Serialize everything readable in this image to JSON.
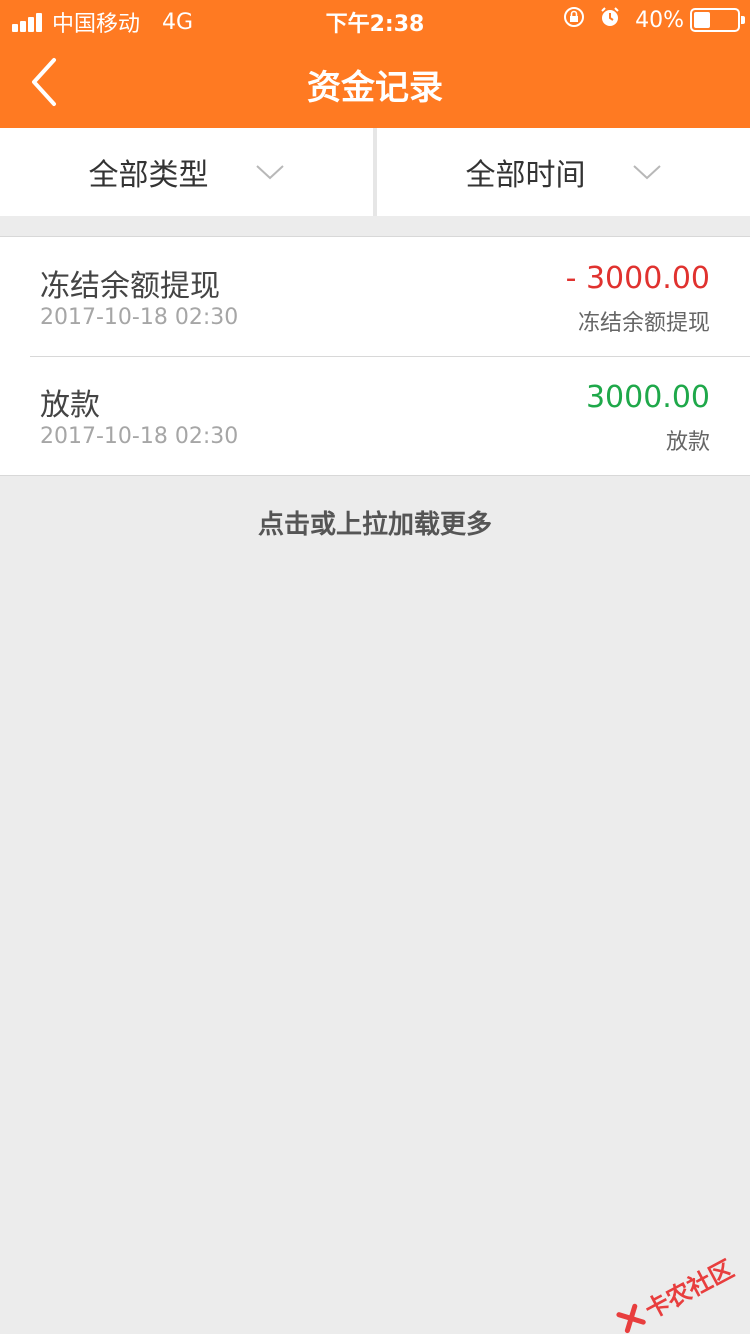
{
  "status_bar": {
    "carrier": "中国移动",
    "network": "4G",
    "time": "下午2:38",
    "battery": "40%",
    "battery_level": 0.4
  },
  "navbar": {
    "title": "资金记录"
  },
  "filters": [
    {
      "label": "全部类型"
    },
    {
      "label": "全部时间"
    }
  ],
  "records": [
    {
      "title": "冻结余额提现",
      "time": "2017-10-18 02:30",
      "amount": "- 3000.00",
      "type": "冻结余额提现",
      "amount_color": "#e0322f"
    },
    {
      "title": "放款",
      "time": "2017-10-18 02:30",
      "amount": "3000.00",
      "type": "放款",
      "amount_color": "#1fa84a"
    }
  ],
  "load_more": "点击或上拉加载更多",
  "watermark": "卡农社区",
  "colors": {
    "brand": "#ff7a22",
    "background": "#ececec"
  }
}
